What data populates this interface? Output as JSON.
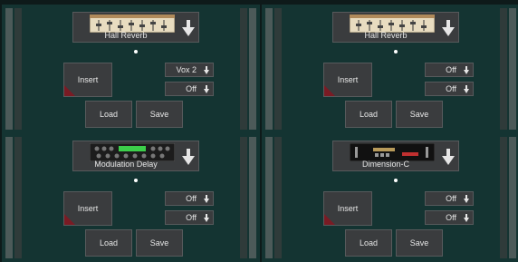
{
  "slots": [
    {
      "effect": "Hall Reverb",
      "thumb": "hall-reverb-thumbnail",
      "insert_label": "Insert",
      "select1": "Vox 2",
      "select2": "Off",
      "load_label": "Load",
      "save_label": "Save"
    },
    {
      "effect": "Hall Reverb",
      "thumb": "hall-reverb-thumbnail",
      "insert_label": "Insert",
      "select1": "Off",
      "select2": "Off",
      "load_label": "Load",
      "save_label": "Save"
    },
    {
      "effect": "Modulation Delay",
      "thumb": "modulation-delay-thumbnail",
      "insert_label": "Insert",
      "select1": "Off",
      "select2": "Off",
      "load_label": "Load",
      "save_label": "Save"
    },
    {
      "effect": "Dimension-C",
      "thumb": "dimension-c-thumbnail",
      "insert_label": "Insert",
      "select1": "Off",
      "select2": "Off",
      "load_label": "Load",
      "save_label": "Save"
    }
  ],
  "colors": {
    "panel": "#143432",
    "button": "#3a3c3e",
    "insert_marker": "#7a1b24"
  },
  "icons": {
    "dropdown": "down-arrow-icon",
    "slot_marker": "dot-icon"
  }
}
